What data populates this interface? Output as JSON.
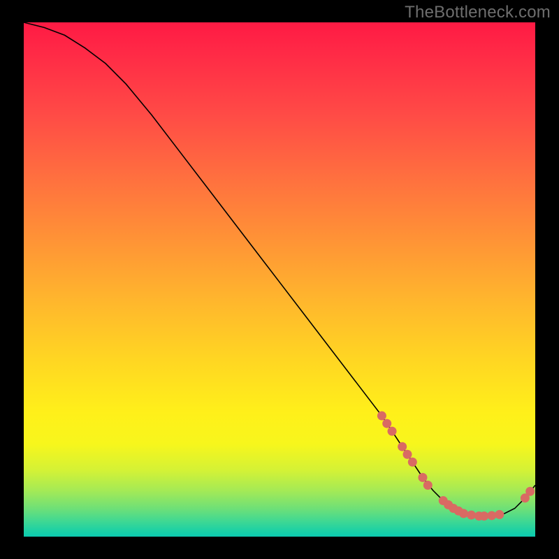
{
  "watermark": "TheBottleneck.com",
  "colors": {
    "background": "#000000",
    "curve": "#000000",
    "marker": "#d96a63",
    "gradient_top": "#ff1a44",
    "gradient_yellow": "#fff01a",
    "gradient_bottom": "#0ccab0",
    "watermark": "#6e6e6e"
  },
  "chart_data": {
    "type": "line",
    "title": "",
    "xlabel": "",
    "ylabel": "",
    "xlim": [
      0,
      100
    ],
    "ylim": [
      0,
      100
    ],
    "x": [
      0,
      4,
      8,
      12,
      16,
      20,
      25,
      30,
      35,
      40,
      45,
      50,
      55,
      60,
      65,
      70,
      72,
      74,
      76,
      78,
      80,
      82,
      84,
      86,
      88,
      90,
      92,
      94,
      96,
      98,
      100
    ],
    "y": [
      100,
      99,
      97.5,
      95,
      92,
      88,
      82,
      75.5,
      69,
      62.5,
      56,
      49.5,
      43,
      36.5,
      30,
      23.5,
      20.5,
      17.5,
      14.5,
      11.5,
      9,
      7,
      5.5,
      4.5,
      4,
      4,
      4.2,
      4.5,
      5.5,
      7.5,
      10
    ],
    "markers": [
      {
        "x": 70,
        "y": 23.5
      },
      {
        "x": 71,
        "y": 22
      },
      {
        "x": 72,
        "y": 20.5
      },
      {
        "x": 74,
        "y": 17.5
      },
      {
        "x": 75,
        "y": 16
      },
      {
        "x": 76,
        "y": 14.5
      },
      {
        "x": 78,
        "y": 11.5
      },
      {
        "x": 79,
        "y": 10
      },
      {
        "x": 82,
        "y": 7
      },
      {
        "x": 83,
        "y": 6.2
      },
      {
        "x": 84,
        "y": 5.5
      },
      {
        "x": 85,
        "y": 5
      },
      {
        "x": 86,
        "y": 4.5
      },
      {
        "x": 87.5,
        "y": 4.2
      },
      {
        "x": 89,
        "y": 4
      },
      {
        "x": 90,
        "y": 4
      },
      {
        "x": 91.5,
        "y": 4.1
      },
      {
        "x": 93,
        "y": 4.3
      },
      {
        "x": 98,
        "y": 7.5
      },
      {
        "x": 99,
        "y": 8.8
      }
    ]
  }
}
